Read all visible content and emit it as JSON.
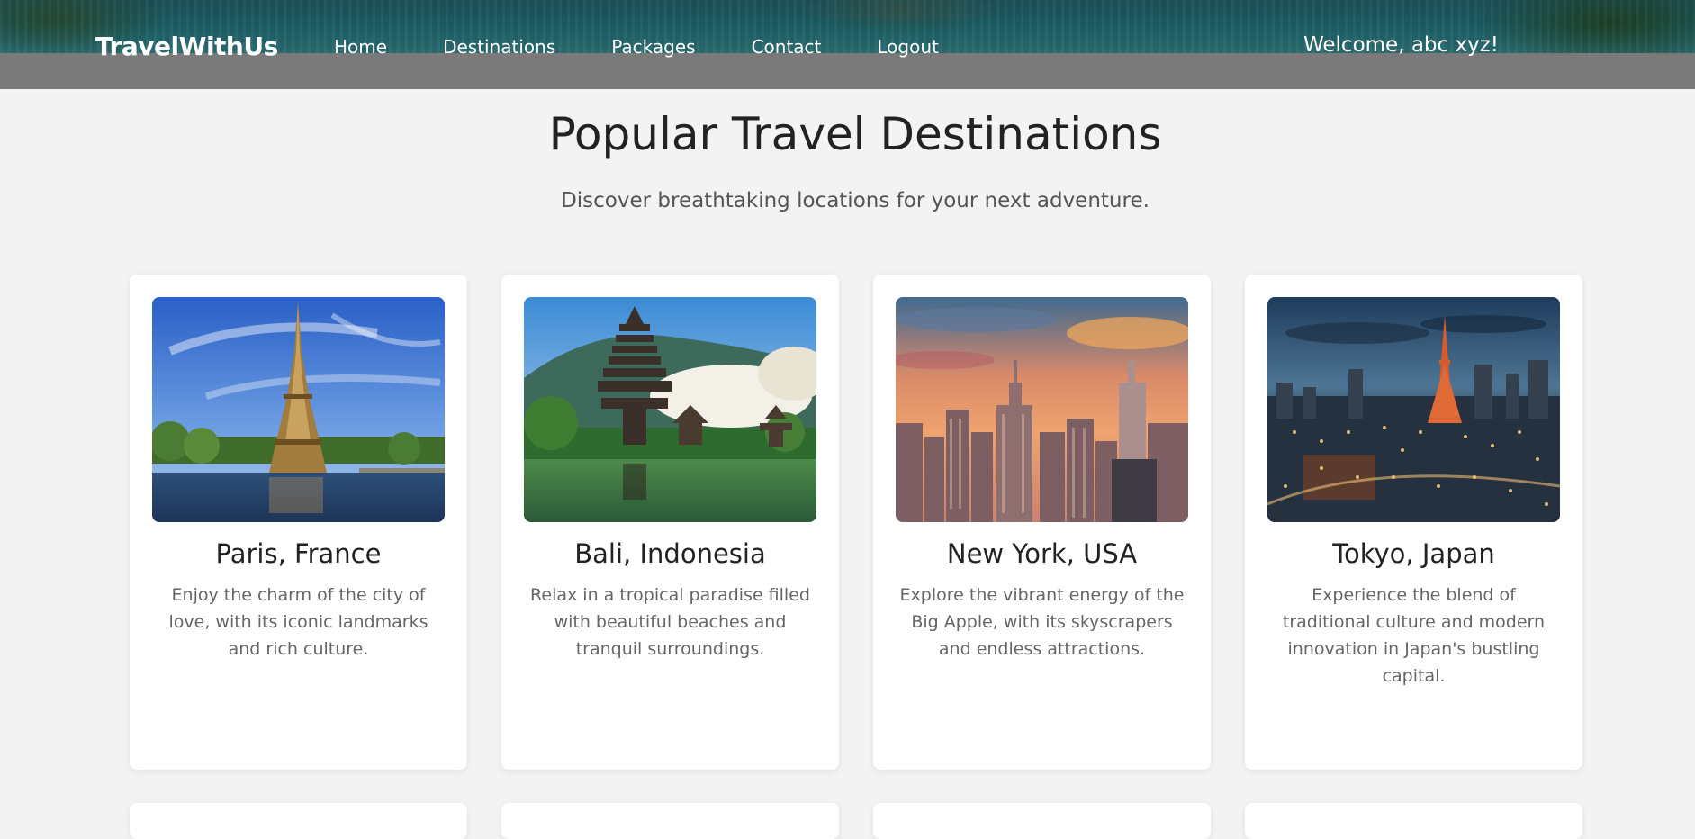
{
  "header": {
    "brand": "TravelWithUs",
    "nav": [
      "Home",
      "Destinations",
      "Packages",
      "Contact",
      "Logout"
    ],
    "welcome": "Welcome, abc xyz!"
  },
  "hero": {
    "title": "Popular Travel Destinations",
    "subtitle": "Discover breathtaking locations for your next adventure."
  },
  "destinations": [
    {
      "title": "Paris, France",
      "description": "Enjoy the charm of the city of love, with its iconic landmarks and rich culture.",
      "image_icon": "eiffel-tower-photo"
    },
    {
      "title": "Bali, Indonesia",
      "description": "Relax in a tropical paradise filled with beautiful beaches and tranquil surroundings.",
      "image_icon": "bali-temple-photo"
    },
    {
      "title": "New York, USA",
      "description": "Explore the vibrant energy of the Big Apple, with its skyscrapers and endless attractions.",
      "image_icon": "new-york-skyline-photo"
    },
    {
      "title": "Tokyo, Japan",
      "description": "Experience the blend of traditional culture and modern innovation in Japan's bustling capital.",
      "image_icon": "tokyo-night-photo"
    }
  ]
}
